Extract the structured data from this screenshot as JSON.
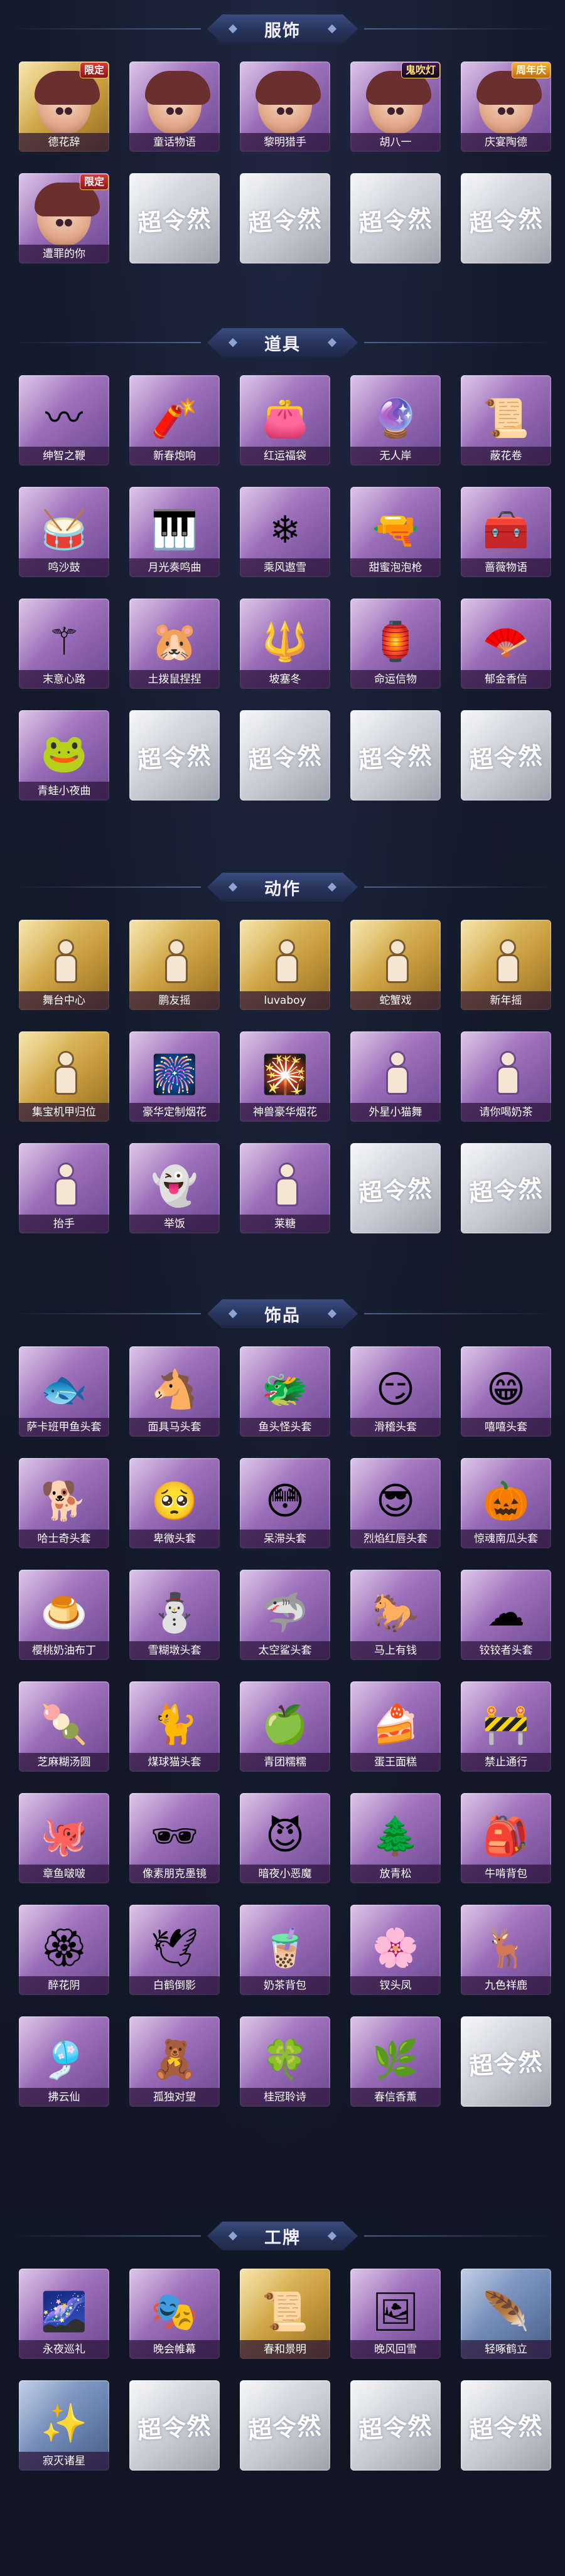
{
  "placeholder_text": "超令然",
  "sections": [
    {
      "title": "服饰",
      "items": [
        {
          "label": "德花辞",
          "rarity": "gold",
          "badge": "限定",
          "badge_type": "limited",
          "icon": "red-hood-avatar-icon"
        },
        {
          "label": "童话物语",
          "rarity": "purple",
          "icon": "girl-avatar-icon"
        },
        {
          "label": "黎明猎手",
          "rarity": "purple",
          "icon": "hunter-avatar-icon"
        },
        {
          "label": "胡八一",
          "rarity": "purple",
          "badge": "鬼吹灯",
          "badge_type": "coop",
          "icon": "explorer-avatar-icon"
        },
        {
          "label": "庆宴陶德",
          "rarity": "purple",
          "badge": "周年庆",
          "badge_type": "anniv",
          "icon": "party-avatar-icon"
        },
        {
          "label": "遭罪的你",
          "rarity": "purple",
          "badge": "限定",
          "badge_type": "limited",
          "icon": "cowboy-avatar-icon"
        },
        {
          "placeholder": true,
          "rarity": "silver"
        },
        {
          "placeholder": true,
          "rarity": "silver"
        },
        {
          "placeholder": true,
          "rarity": "silver"
        },
        {
          "placeholder": true,
          "rarity": "silver"
        }
      ]
    },
    {
      "title": "道具",
      "items": [
        {
          "label": "绅智之鞭",
          "rarity": "purple",
          "icon": "whip-icon",
          "glyph": "〰"
        },
        {
          "label": "新春炮响",
          "rarity": "purple",
          "icon": "firecracker-icon",
          "glyph": "🧨"
        },
        {
          "label": "红运福袋",
          "rarity": "purple",
          "icon": "lucky-bag-icon",
          "glyph": "👛"
        },
        {
          "label": "无人岸",
          "rarity": "purple",
          "icon": "orb-icon",
          "glyph": "🔮"
        },
        {
          "label": "蔽花卷",
          "rarity": "purple",
          "icon": "scroll-icon",
          "glyph": "📜"
        },
        {
          "label": "鸣沙鼓",
          "rarity": "purple",
          "icon": "drum-icon",
          "glyph": "🥁"
        },
        {
          "label": "月光奏鸣曲",
          "rarity": "purple",
          "icon": "music-box-icon",
          "glyph": "🎹"
        },
        {
          "label": "乘风遨雪",
          "rarity": "purple",
          "icon": "snow-machine-icon",
          "glyph": "❄"
        },
        {
          "label": "甜蜜泡泡枪",
          "rarity": "purple",
          "icon": "bubble-gun-icon",
          "glyph": "🔫"
        },
        {
          "label": "蔷薇物语",
          "rarity": "purple",
          "icon": "first-aid-kit-icon",
          "glyph": "🧰"
        },
        {
          "label": "末意心路",
          "rarity": "purple",
          "icon": "staff-icon",
          "glyph": "⚚"
        },
        {
          "label": "土拨鼠捏捏",
          "rarity": "purple",
          "icon": "groundhog-icon",
          "glyph": "🐹"
        },
        {
          "label": "坡塞冬",
          "rarity": "purple",
          "icon": "trident-icon",
          "glyph": "🔱"
        },
        {
          "label": "命运信物",
          "rarity": "purple",
          "icon": "lantern-icon",
          "glyph": "🏮"
        },
        {
          "label": "郁金香信",
          "rarity": "purple",
          "icon": "fan-icon",
          "glyph": "🪭"
        },
        {
          "label": "青蛙小夜曲",
          "rarity": "purple",
          "icon": "frog-icon",
          "glyph": "🐸"
        },
        {
          "placeholder": true,
          "rarity": "silver"
        },
        {
          "placeholder": true,
          "rarity": "silver"
        },
        {
          "placeholder": true,
          "rarity": "silver"
        },
        {
          "placeholder": true,
          "rarity": "silver"
        }
      ]
    },
    {
      "title": "动作",
      "items": [
        {
          "label": "舞台中心",
          "rarity": "gold",
          "icon": "pose-icon"
        },
        {
          "label": "鹏友摇",
          "rarity": "gold",
          "icon": "pose-icon"
        },
        {
          "label": "luvaboy",
          "rarity": "gold",
          "icon": "pose-icon"
        },
        {
          "label": "蛇蟹戏",
          "rarity": "gold",
          "icon": "pose-icon"
        },
        {
          "label": "新年摇",
          "rarity": "gold",
          "icon": "pose-icon"
        },
        {
          "label": "集宝机甲归位",
          "rarity": "gold",
          "icon": "pose-icon"
        },
        {
          "label": "豪华定制烟花",
          "rarity": "purple",
          "icon": "fireworks-icon",
          "glyph": "🎆"
        },
        {
          "label": "神兽豪华烟花",
          "rarity": "purple",
          "icon": "fireworks-icon",
          "glyph": "🎇"
        },
        {
          "label": "外星小猫舞",
          "rarity": "purple",
          "icon": "pose-icon"
        },
        {
          "label": "请你喝奶茶",
          "rarity": "purple",
          "icon": "pose-icon"
        },
        {
          "label": "抬手",
          "rarity": "purple",
          "icon": "pose-icon"
        },
        {
          "label": "举饭",
          "rarity": "purple",
          "icon": "ghost-icon",
          "glyph": "👻"
        },
        {
          "label": "莱糖",
          "rarity": "purple",
          "icon": "pose-icon"
        },
        {
          "placeholder": true,
          "rarity": "silver"
        },
        {
          "placeholder": true,
          "rarity": "silver"
        }
      ]
    },
    {
      "title": "饰品",
      "items": [
        {
          "label": "萨卡班甲鱼头套",
          "rarity": "purple",
          "icon": "fish-head-icon",
          "glyph": "🐟"
        },
        {
          "label": "面具马头套",
          "rarity": "purple",
          "icon": "horse-head-icon",
          "glyph": "🐴"
        },
        {
          "label": "鱼头怪头套",
          "rarity": "purple",
          "icon": "fish-monster-icon",
          "glyph": "🐲"
        },
        {
          "label": "滑稽头套",
          "rarity": "purple",
          "icon": "smirk-face-icon",
          "glyph": "😏"
        },
        {
          "label": "嘻嘻头套",
          "rarity": "purple",
          "icon": "grin-face-icon",
          "glyph": "😁"
        },
        {
          "label": "哈士奇头套",
          "rarity": "purple",
          "icon": "husky-icon",
          "glyph": "🐕"
        },
        {
          "label": "卑微头套",
          "rarity": "purple",
          "icon": "sad-face-icon",
          "glyph": "🥺"
        },
        {
          "label": "呆滞头套",
          "rarity": "purple",
          "icon": "dazed-face-icon",
          "glyph": "😳"
        },
        {
          "label": "烈焰红唇头套",
          "rarity": "purple",
          "icon": "cool-cat-icon",
          "glyph": "😎"
        },
        {
          "label": "惊魂南瓜头套",
          "rarity": "purple",
          "icon": "pumpkin-icon",
          "glyph": "🎃"
        },
        {
          "label": "樱桃奶油布丁",
          "rarity": "purple",
          "icon": "pudding-icon",
          "glyph": "🍮"
        },
        {
          "label": "雪糊墩头套",
          "rarity": "purple",
          "icon": "snowman-icon",
          "glyph": "⛄"
        },
        {
          "label": "太空鲨头套",
          "rarity": "purple",
          "icon": "shark-icon",
          "glyph": "🦈"
        },
        {
          "label": "马上有钱",
          "rarity": "purple",
          "icon": "horse-money-icon",
          "glyph": "🐎"
        },
        {
          "label": "铰铰者头套",
          "rarity": "purple",
          "icon": "cloud-icon",
          "glyph": "☁"
        },
        {
          "label": "芝麻糊汤圆",
          "rarity": "purple",
          "icon": "dumpling-icon",
          "glyph": "🍡"
        },
        {
          "label": "煤球猫头套",
          "rarity": "purple",
          "icon": "black-cat-icon",
          "glyph": "🐈"
        },
        {
          "label": "青团糯糯",
          "rarity": "purple",
          "icon": "green-bun-icon",
          "glyph": "🍏"
        },
        {
          "label": "蛋王面糕",
          "rarity": "purple",
          "icon": "cake-icon",
          "glyph": "🍰"
        },
        {
          "label": "禁止通行",
          "rarity": "purple",
          "icon": "traffic-cone-icon",
          "glyph": "🚧"
        },
        {
          "label": "章鱼啵啵",
          "rarity": "purple",
          "icon": "octopus-icon",
          "glyph": "🐙"
        },
        {
          "label": "像素朋克墨镜",
          "rarity": "purple",
          "icon": "pixel-glasses-icon",
          "glyph": "🕶"
        },
        {
          "label": "暗夜小恶魔",
          "rarity": "purple",
          "icon": "devil-icon",
          "glyph": "😈"
        },
        {
          "label": "放青松",
          "rarity": "purple",
          "icon": "bonsai-icon",
          "glyph": "🌲"
        },
        {
          "label": "牛啃背包",
          "rarity": "purple",
          "icon": "backpack-icon",
          "glyph": "🎒"
        },
        {
          "label": "醉花阴",
          "rarity": "purple",
          "icon": "flower-pendant-icon",
          "glyph": "🏵"
        },
        {
          "label": "白鹤倒影",
          "rarity": "purple",
          "icon": "crane-icon",
          "glyph": "🕊"
        },
        {
          "label": "奶茶背包",
          "rarity": "purple",
          "icon": "milk-tea-icon",
          "glyph": "🧋"
        },
        {
          "label": "钗头凤",
          "rarity": "purple",
          "icon": "hairpin-icon",
          "glyph": "🌸"
        },
        {
          "label": "九色祥鹿",
          "rarity": "purple",
          "icon": "deer-icon",
          "glyph": "🦌"
        },
        {
          "label": "拂云仙",
          "rarity": "purple",
          "icon": "cloud-pendant-icon",
          "glyph": "🎐"
        },
        {
          "label": "孤独对望",
          "rarity": "purple",
          "icon": "doll-icon",
          "glyph": "🧸"
        },
        {
          "label": "桂冠聆诗",
          "rarity": "purple",
          "icon": "laurel-icon",
          "glyph": "🍀"
        },
        {
          "label": "春信香薰",
          "rarity": "purple",
          "icon": "aroma-icon",
          "glyph": "🌿"
        },
        {
          "placeholder": true,
          "rarity": "silver"
        }
      ]
    },
    {
      "title": "工牌",
      "items": [
        {
          "label": "永夜巡礼",
          "rarity": "purple",
          "icon": "badge-card-icon",
          "glyph": "🌌"
        },
        {
          "label": "晚会帷幕",
          "rarity": "purple",
          "icon": "badge-card-icon",
          "glyph": "🎭"
        },
        {
          "label": "春和景明",
          "rarity": "gold",
          "icon": "badge-card-icon",
          "glyph": "📜"
        },
        {
          "label": "晚风回雪",
          "rarity": "purple",
          "icon": "badge-card-icon",
          "glyph": "🖼"
        },
        {
          "label": "轻啄鹤立",
          "rarity": "blue",
          "icon": "badge-card-icon",
          "glyph": "🪶"
        },
        {
          "label": "寂灭诸星",
          "rarity": "blue",
          "icon": "badge-card-icon",
          "glyph": "✨"
        },
        {
          "placeholder": true,
          "rarity": "silver"
        },
        {
          "placeholder": true,
          "rarity": "silver"
        },
        {
          "placeholder": true,
          "rarity": "silver"
        },
        {
          "placeholder": true,
          "rarity": "silver"
        }
      ]
    }
  ]
}
